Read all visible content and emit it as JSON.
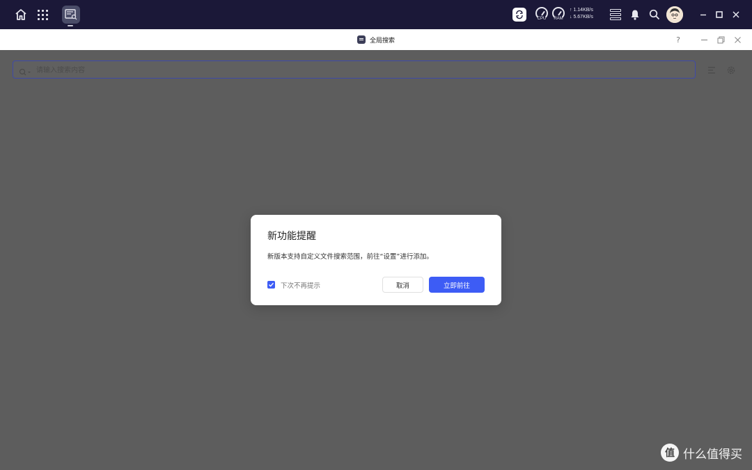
{
  "system_bar": {
    "cpu_label": "CPU",
    "ram_label": "RAM",
    "upload_speed": "↑ 1.14KB/s",
    "download_speed": "↓ 5.67KB/s",
    "icons": [
      "home-icon",
      "apps-grid-icon",
      "global-search-app-icon",
      "sync-icon",
      "cpu-gauge-icon",
      "ram-gauge-icon",
      "server-icon",
      "bell-icon",
      "search-icon",
      "avatar",
      "minimize-icon",
      "maximize-icon",
      "close-icon"
    ]
  },
  "window": {
    "title": "全局搜索",
    "help_label": "?",
    "icons": [
      "help-icon",
      "minimize-icon",
      "restore-icon",
      "close-icon"
    ]
  },
  "search": {
    "placeholder": "请输入搜索内容",
    "icons": [
      "search-icon",
      "chevron-down-icon",
      "filter-list-icon",
      "settings-icon"
    ]
  },
  "modal": {
    "title": "新功能提醒",
    "message": "新版本支持自定义文件搜索范围，前往“设置”进行添加。",
    "checkbox_label": "下次不再提示",
    "checkbox_checked": true,
    "cancel_label": "取消",
    "confirm_label": "立即前往",
    "accent_color": "#3d5cf5"
  },
  "watermark": {
    "logo_text": "值",
    "text": "什么值得买"
  },
  "colors": {
    "system_bar": "#1b1838",
    "overlay": "#5d5d5d",
    "primary": "#3d5cf5"
  }
}
